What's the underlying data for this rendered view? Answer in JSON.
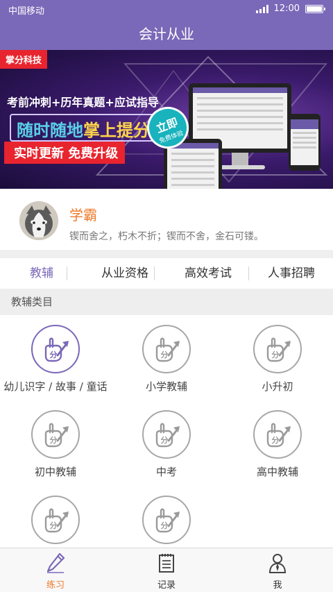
{
  "status_bar": {
    "carrier": "中国移动",
    "time": "12:00"
  },
  "header": {
    "title": "会计从业"
  },
  "banner": {
    "brand": "掌分科技",
    "line1": "考前冲刺+历年真题+应试指导",
    "line2_part1": "随时随地",
    "line2_part2": "掌上提分",
    "line3": "实时更新 免费升级",
    "stamp_main": "立即",
    "stamp_sub": "免费体验"
  },
  "profile": {
    "name": "学霸",
    "quote": "锲而舍之，朽木不折；锲而不舍，金石可镂。"
  },
  "tabs": [
    {
      "label": "教辅",
      "active": true
    },
    {
      "label": "从业资格",
      "active": false
    },
    {
      "label": "高效考试",
      "active": false
    },
    {
      "label": "人事招聘",
      "active": false
    }
  ],
  "category_header": "教辅类目",
  "categories": [
    {
      "label": "幼儿识字 / 故事 / 童话",
      "icon": "score-up-icon",
      "active": true
    },
    {
      "label": "小学教辅",
      "icon": "score-up-icon",
      "active": false
    },
    {
      "label": "小升初",
      "icon": "score-up-icon",
      "active": false
    },
    {
      "label": "初中教辅",
      "icon": "score-up-icon",
      "active": false
    },
    {
      "label": "中考",
      "icon": "score-up-icon",
      "active": false
    },
    {
      "label": "高中教辅",
      "icon": "score-up-icon",
      "active": false
    },
    {
      "label": "",
      "icon": "score-up-icon",
      "active": false
    },
    {
      "label": "",
      "icon": "score-up-icon",
      "active": false
    }
  ],
  "bottom_nav": [
    {
      "label": "练习",
      "icon": "pencil-icon",
      "active": true
    },
    {
      "label": "记录",
      "icon": "notebook-icon",
      "active": false
    },
    {
      "label": "我",
      "icon": "person-icon",
      "active": false
    }
  ],
  "colors": {
    "accent": "#7a68b8",
    "highlight": "#ee7a2b",
    "banner_red": "#e8242e"
  }
}
